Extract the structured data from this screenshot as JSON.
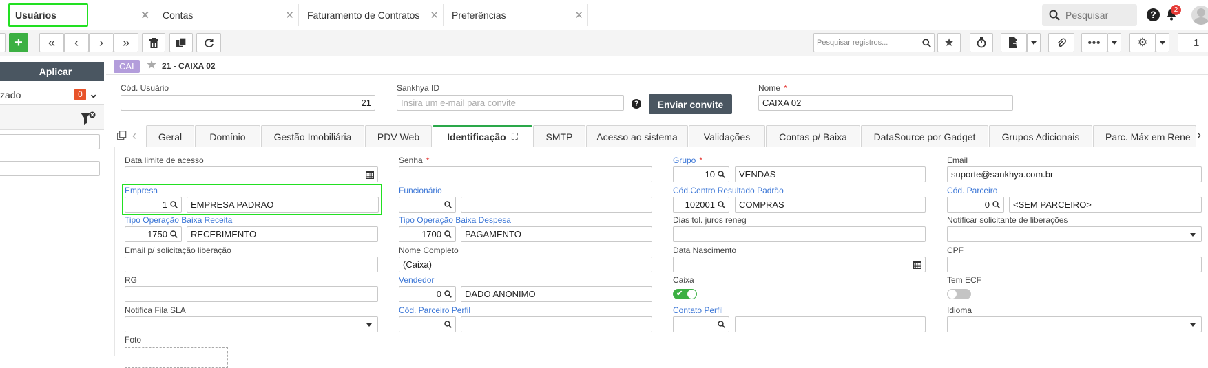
{
  "window_tabs": [
    {
      "label": "Usuários"
    },
    {
      "label": "Contas"
    },
    {
      "label": "Faturamento de Contratos"
    },
    {
      "label": "Preferências"
    }
  ],
  "header": {
    "search_label": "Pesquisar",
    "notifications_count": "2"
  },
  "toolbar": {
    "search_placeholder": "Pesquisar registros...",
    "page": "1"
  },
  "left_panel": {
    "apply_label": "Aplicar",
    "filter_label": "zado",
    "filter_count": "0"
  },
  "record": {
    "badge": "CAI",
    "title": "21 - CAIXA 02"
  },
  "top_fields": {
    "cod_usuario_label": "Cód. Usuário",
    "cod_usuario": "21",
    "sankhya_id_label": "Sankhya ID",
    "sankhya_id_placeholder": "Insira um e-mail para convite",
    "invite_button": "Enviar convite",
    "nome_label": "Nome",
    "nome": "CAIXA 02"
  },
  "form_tabs": [
    "Geral",
    "Domínio",
    "Gestão Imobiliária",
    "PDV Web",
    "Identificação",
    "SMTP",
    "Acesso ao sistema",
    "Validações",
    "Contas p/ Baixa",
    "DataSource por Gadget",
    "Grupos Adicionais",
    "Parc. Máx em Rene"
  ],
  "fields": {
    "data_limite_label": "Data limite de acesso",
    "senha_label": "Senha",
    "grupo_label": "Grupo",
    "grupo_code": "10",
    "grupo_name": "VENDAS",
    "email_label": "Email",
    "email": "suporte@sankhya.com.br",
    "empresa_label": "Empresa",
    "empresa_code": "1",
    "empresa_name": "EMPRESA PADRAO",
    "funcionario_label": "Funcionário",
    "cr_label": "Cód.Centro Resultado Padrão",
    "cr_code": "102001",
    "cr_name": "COMPRAS",
    "parceiro_label": "Cód. Parceiro",
    "parceiro_code": "0",
    "parceiro_name": "<SEM PARCEIRO>",
    "top_receita_label": "Tipo Operação Baixa Receita",
    "top_receita_code": "1750",
    "top_receita_name": "RECEBIMENTO",
    "top_despesa_label": "Tipo Operação Baixa Despesa",
    "top_despesa_code": "1700",
    "top_despesa_name": "PAGAMENTO",
    "dias_tol_label": "Dias tol. juros reneg",
    "notificar_label": "Notificar solicitante de liberações",
    "email_lib_label": "Email p/ solicitação liberação",
    "nome_completo_label": "Nome Completo",
    "nome_completo": "(Caixa)",
    "data_nasc_label": "Data Nascimento",
    "cpf_label": "CPF",
    "rg_label": "RG",
    "vendedor_label": "Vendedor",
    "vendedor_code": "0",
    "vendedor_name": "DADO ANONIMO",
    "caixa_label": "Caixa",
    "tem_ecf_label": "Tem ECF",
    "fila_sla_label": "Notifica Fila SLA",
    "parceiro_perfil_label": "Cód. Parceiro Perfil",
    "contato_perfil_label": "Contato Perfil",
    "idioma_label": "Idioma",
    "foto_label": "Foto"
  },
  "toggles": {
    "caixa_on": true,
    "tem_ecf_on": false
  },
  "colors": {
    "accent_green": "#2aa84a",
    "highlight": "#22e022",
    "link": "#3b76d6",
    "badge": "#b39ddb",
    "button_dark": "#4a5661"
  }
}
